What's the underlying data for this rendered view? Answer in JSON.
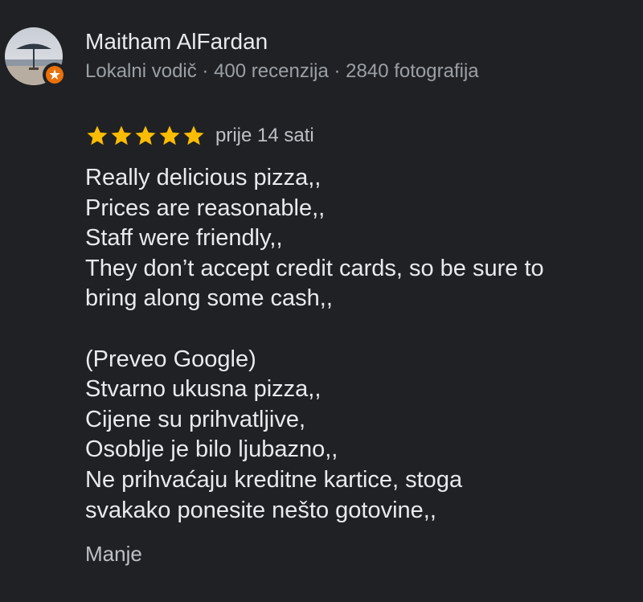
{
  "author": {
    "name": "Maitham AlFardan",
    "meta": "Lokalni vodič · 400 recenzija · 2840 fotografija",
    "avatar_icon": "beach-umbrella-photo",
    "badge_icon": "local-guide-star-icon",
    "badge_color": "#e8710a"
  },
  "rating": {
    "stars": 5,
    "max_stars": 5,
    "star_color": "#fbbc04",
    "time_ago": "prije 14 sati"
  },
  "review": {
    "lines": [
      "Really delicious pizza,,",
      "Prices are reasonable,,",
      "Staff were friendly,,",
      "They don’t accept credit cards, so be sure to",
      "bring along some cash,,"
    ],
    "translation_label": "(Preveo Google)",
    "translated_lines": [
      "Stvarno ukusna pizza,,",
      "Cijene su prihvatljive,",
      "Osoblje je bilo ljubazno,,",
      "Ne prihvaćaju kreditne kartice, stoga",
      "svakako ponesite nešto gotovine,,"
    ]
  },
  "actions": {
    "less_label": "Manje"
  }
}
